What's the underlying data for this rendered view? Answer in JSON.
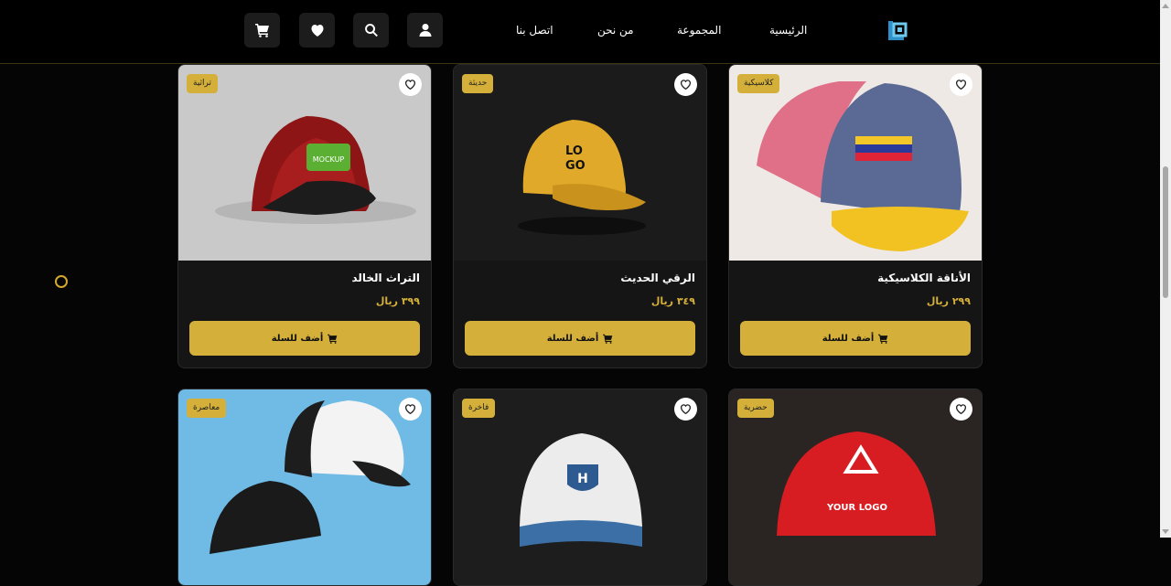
{
  "header": {
    "nav": {
      "home": "الرئيسية",
      "collection": "المجموعة",
      "about": "من نحن",
      "contact": "اتصل بنا"
    },
    "icons": [
      "cart-icon",
      "heart-icon",
      "search-icon",
      "user-icon"
    ]
  },
  "colors": {
    "accent": "#d4b03a",
    "background": "#050505",
    "card": "#151515"
  },
  "products": [
    {
      "badge": "تراثية",
      "title": "التراث الخالد",
      "price": "٣٩٩ ريال",
      "button": "أضف للسلة"
    },
    {
      "badge": "حديثة",
      "title": "الرقي الحديث",
      "price": "٣٤٩ ريال",
      "button": "أضف للسلة"
    },
    {
      "badge": "كلاسيكية",
      "title": "الأناقة الكلاسيكية",
      "price": "٢٩٩ ريال",
      "button": "أضف للسلة"
    },
    {
      "badge": "معاصرة"
    },
    {
      "badge": "فاخرة"
    },
    {
      "badge": "حضرية"
    }
  ]
}
